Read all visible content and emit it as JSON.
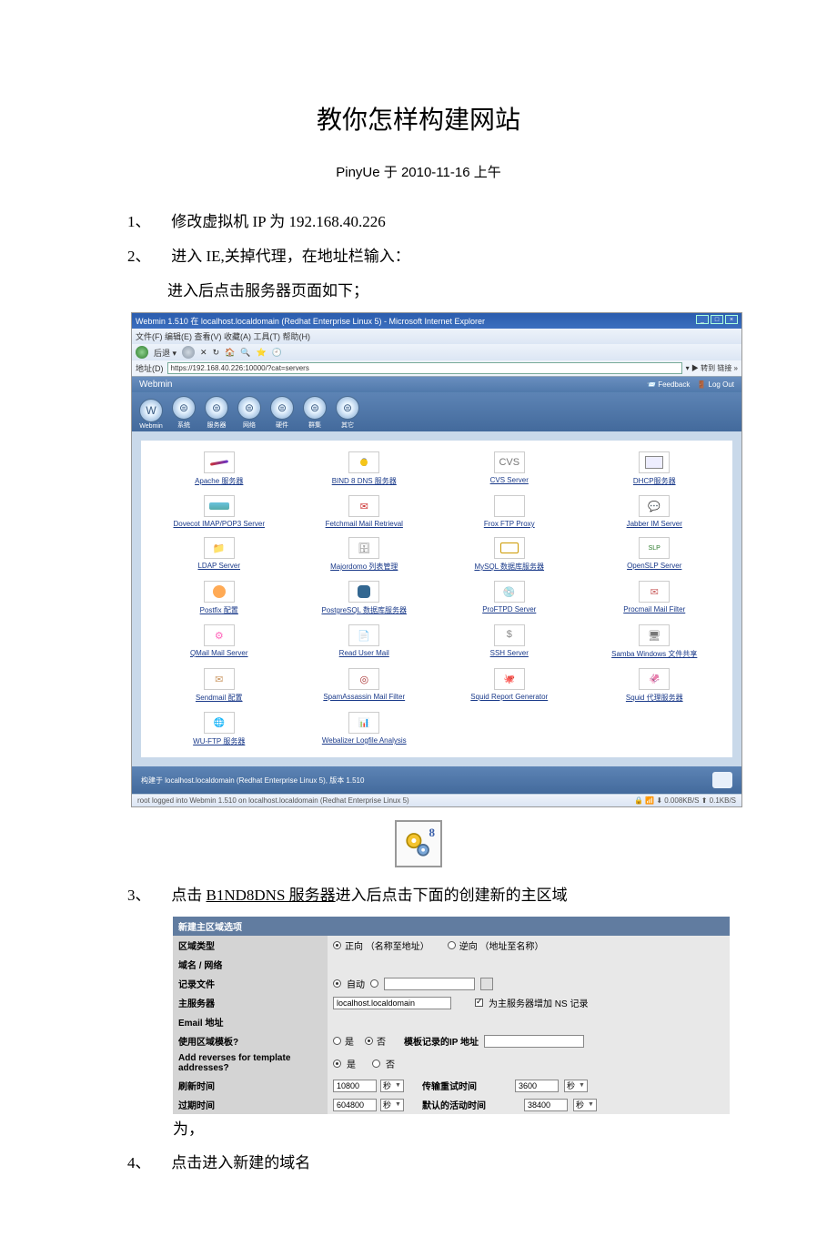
{
  "title": "教你怎样构建网站",
  "byline": "PinyUe 于 2010-11-16 上午",
  "steps": {
    "s1": {
      "num": "1、",
      "txt": "修改虚拟机 IP 为 192.168.40.226"
    },
    "s2": {
      "num": "2、",
      "txt": "进入 IE,关掉代理，在地址栏输入：",
      "sub": "进入后点击服务器页面如下；"
    },
    "s3": {
      "num": "3、",
      "pre": "点击 ",
      "link": "B1ND8DNS 服务器",
      "post": "进入后点击下面的创建新的主区域"
    },
    "s4": {
      "num": "4、",
      "txt": "点击进入新建的域名"
    }
  },
  "ie": {
    "title": "Webmin 1.510 在 localhost.localdomain (Redhat Enterprise Linux 5) - Microsoft Internet Explorer",
    "win_min": "_",
    "win_max": "□",
    "win_close": "×",
    "menu": "文件(F)  编辑(E)  查看(V)  收藏(A)  工具(T)  帮助(H)",
    "toolbar_text": "后退 ▾",
    "addr_label": "地址(D)",
    "addr_url": "https://192.168.40.226:10000/?cat=servers",
    "addr_right": "▾ ▶ 转到  链接 »",
    "status_left": "root logged into Webmin 1.510 on localhost.localdomain (Redhat Enterprise Linux 5)",
    "status_right": "🔒 📶 ⬇ 0.008KB/S ⬆ 0.1KB/S"
  },
  "webmin": {
    "brand": "Webmin",
    "feedback": "📨 Feedback",
    "logout": "🚪 Log Out",
    "tabs": [
      "Webmin",
      "系统",
      "服务器",
      "网络",
      "硬件",
      "群集",
      "其它"
    ],
    "tab_glyphs": [
      "W",
      "⊜",
      "⊜",
      "⊜",
      "⊜",
      "⊜",
      "⊜"
    ],
    "servers": [
      {
        "label": "Apache 服务器",
        "cls": "feather"
      },
      {
        "label": "BIND 8 DNS 服务器",
        "cls": "dns8"
      },
      {
        "label": "CVS Server",
        "cls": "blueblk",
        "inner": "CVS"
      },
      {
        "label": "DHCP服务器",
        "cls": "monitor"
      },
      {
        "label": "Dovecot IMAP/POP3 Server",
        "cls": "dovecot"
      },
      {
        "label": "Fetchmail Mail Retrieval",
        "cls": "mailico"
      },
      {
        "label": "Frox FTP Proxy",
        "cls": "blank"
      },
      {
        "label": "Jabber IM Server",
        "cls": "chat"
      },
      {
        "label": "LDAP Server",
        "cls": "folder"
      },
      {
        "label": "Majordomo 列表管理",
        "cls": "db"
      },
      {
        "label": "MySQL 数据库服务器",
        "cls": "mysql"
      },
      {
        "label": "OpenSLP Server",
        "cls": "slp"
      },
      {
        "label": "Postfix 配置",
        "cls": "pglogo"
      },
      {
        "label": "PostgreSQL 数据库服务器",
        "cls": "elephant"
      },
      {
        "label": "ProFTPD Server",
        "cls": "disc"
      },
      {
        "label": "Procmail Mail Filter",
        "cls": "procmail"
      },
      {
        "label": "QMail Mail Server",
        "cls": "qmail"
      },
      {
        "label": "Read User Mail",
        "cls": "paper"
      },
      {
        "label": "SSH Server",
        "cls": "sshico"
      },
      {
        "label": "Samba Windows 文件共享",
        "cls": "samba"
      },
      {
        "label": "Sendmail 配置",
        "cls": "send"
      },
      {
        "label": "SpamAssassin Mail Filter",
        "cls": "target"
      },
      {
        "label": "Squid Report Generator",
        "cls": "squid"
      },
      {
        "label": "Squid 代理服务器",
        "cls": "squid2"
      },
      {
        "label": "WU-FTP 服务器",
        "cls": "wu"
      },
      {
        "label": "Webalizer Logfile Analysis",
        "cls": "chart"
      }
    ],
    "footer": "构建于  localhost.localdomain (Redhat Enterprise Linux 5), 版本  1.510"
  },
  "gear_badge": "8",
  "form": {
    "header": "新建主区域选项",
    "rows": {
      "zonetype": {
        "label": "区域类型",
        "opt1": "正向 （名称至地址）",
        "opt2": "逆向 （地址至名称）"
      },
      "domain": {
        "label": "域名 / 网络"
      },
      "record": {
        "label": "记录文件",
        "auto": "自动"
      },
      "master": {
        "label": "主服务器",
        "value": "localhost.localdomain",
        "ns": "为主服务器增加 NS 记录"
      },
      "email": {
        "label": "Email 地址"
      },
      "tmpl": {
        "label": "使用区域模板?",
        "yes": "是",
        "no": "否",
        "iplabel": "模板记录的IP 地址"
      },
      "addrev": {
        "label": "Add reverses for template addresses?",
        "yes": "是",
        "no": "否"
      },
      "refresh": {
        "label": "刷新时间",
        "val": "10800",
        "unit": "秒",
        "retry_label": "传输重试时间",
        "retry_val": "3600",
        "retry_unit": "秒"
      },
      "expire": {
        "label": "过期时间",
        "val": "604800",
        "unit": "秒",
        "ttl_label": "默认的活动时间",
        "ttl_val": "38400",
        "ttl_unit": "秒"
      }
    }
  },
  "wei": "为，"
}
